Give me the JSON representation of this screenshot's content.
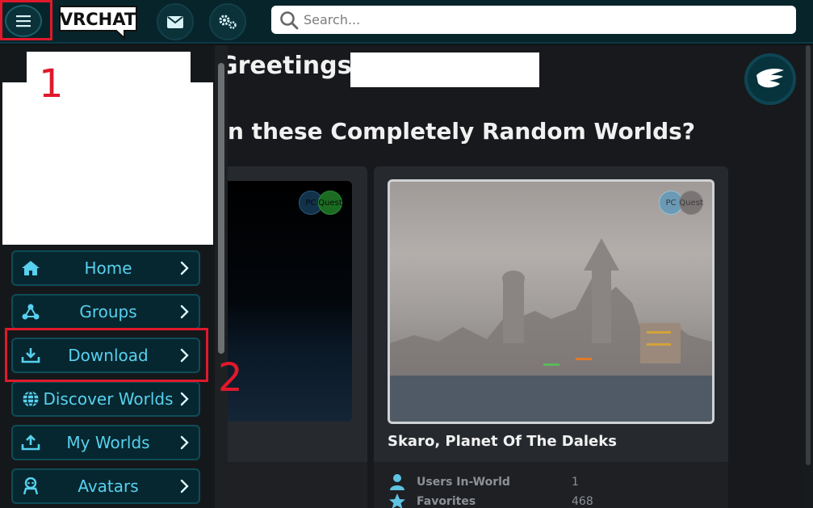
{
  "topbar": {
    "logo_text": "VRCHAT",
    "search_placeholder": "Search..."
  },
  "main": {
    "greeting": "Greetings,",
    "heading": "n these Completely Random Worlds?",
    "world_card": {
      "badge_pc": "PC",
      "badge_quest": "Quest",
      "title": "Skaro, Planet Of The Daleks",
      "stats": [
        {
          "label": "Users In-World",
          "value": "1"
        },
        {
          "label": "Favorites",
          "value": "468"
        }
      ]
    },
    "left_card": {
      "badge_pc": "PC",
      "badge_quest": "Quest"
    }
  },
  "sidebar": {
    "items": [
      {
        "label": "Home",
        "icon": "home-icon"
      },
      {
        "label": "Groups",
        "icon": "groups-icon"
      },
      {
        "label": "Download",
        "icon": "download-icon"
      },
      {
        "label": "Discover Worlds",
        "icon": "globe-icon"
      },
      {
        "label": "My Worlds",
        "icon": "upload-icon"
      },
      {
        "label": "Avatars",
        "icon": "avatar-icon"
      }
    ]
  },
  "annotations": {
    "step1": "1",
    "step2": "2"
  },
  "colors": {
    "accent": "#58d0ef",
    "annotation": "#e0192b",
    "topbar": "#07242b"
  }
}
